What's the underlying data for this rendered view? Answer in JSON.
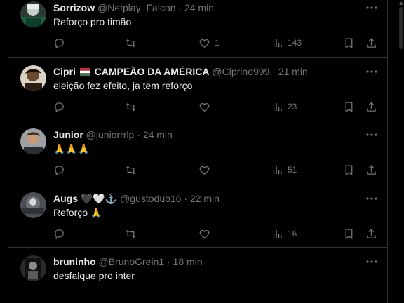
{
  "colors": {
    "background": "#000000",
    "text": "#e7e9ea",
    "muted": "#71767b",
    "divider": "#2f3336"
  },
  "tweets": [
    {
      "name": "Sorrizow",
      "name_extra": "",
      "handle": "@Netplay_Falcon",
      "sep": "·",
      "time": "24 min",
      "text": "Reforço pro timão",
      "likes": "1",
      "views": "143"
    },
    {
      "name": "Cipri",
      "name_extra": "CAMPEÃO DA AMÉRICA",
      "handle": "@Ciprino999",
      "sep": "·",
      "time": "21 min",
      "text": "eleição fez efeito, ja tem reforço",
      "likes": "",
      "views": "23"
    },
    {
      "name": "Junior",
      "name_extra": "",
      "handle": "@juniorrrlp",
      "sep": "·",
      "time": "24 min",
      "text": "🙏🙏🙏",
      "likes": "",
      "views": "51"
    },
    {
      "name": "Augs",
      "name_extra": "🖤🤍⚓",
      "handle": "@gustodub16",
      "sep": "·",
      "time": "22 min",
      "text": "Reforço 🙏",
      "likes": "",
      "views": "16"
    },
    {
      "name": "bruninho",
      "name_extra": "",
      "handle": "@BrunoGrein1",
      "sep": "·",
      "time": "18 min",
      "text": "desfalque pro inter",
      "likes": "",
      "views": ""
    }
  ]
}
